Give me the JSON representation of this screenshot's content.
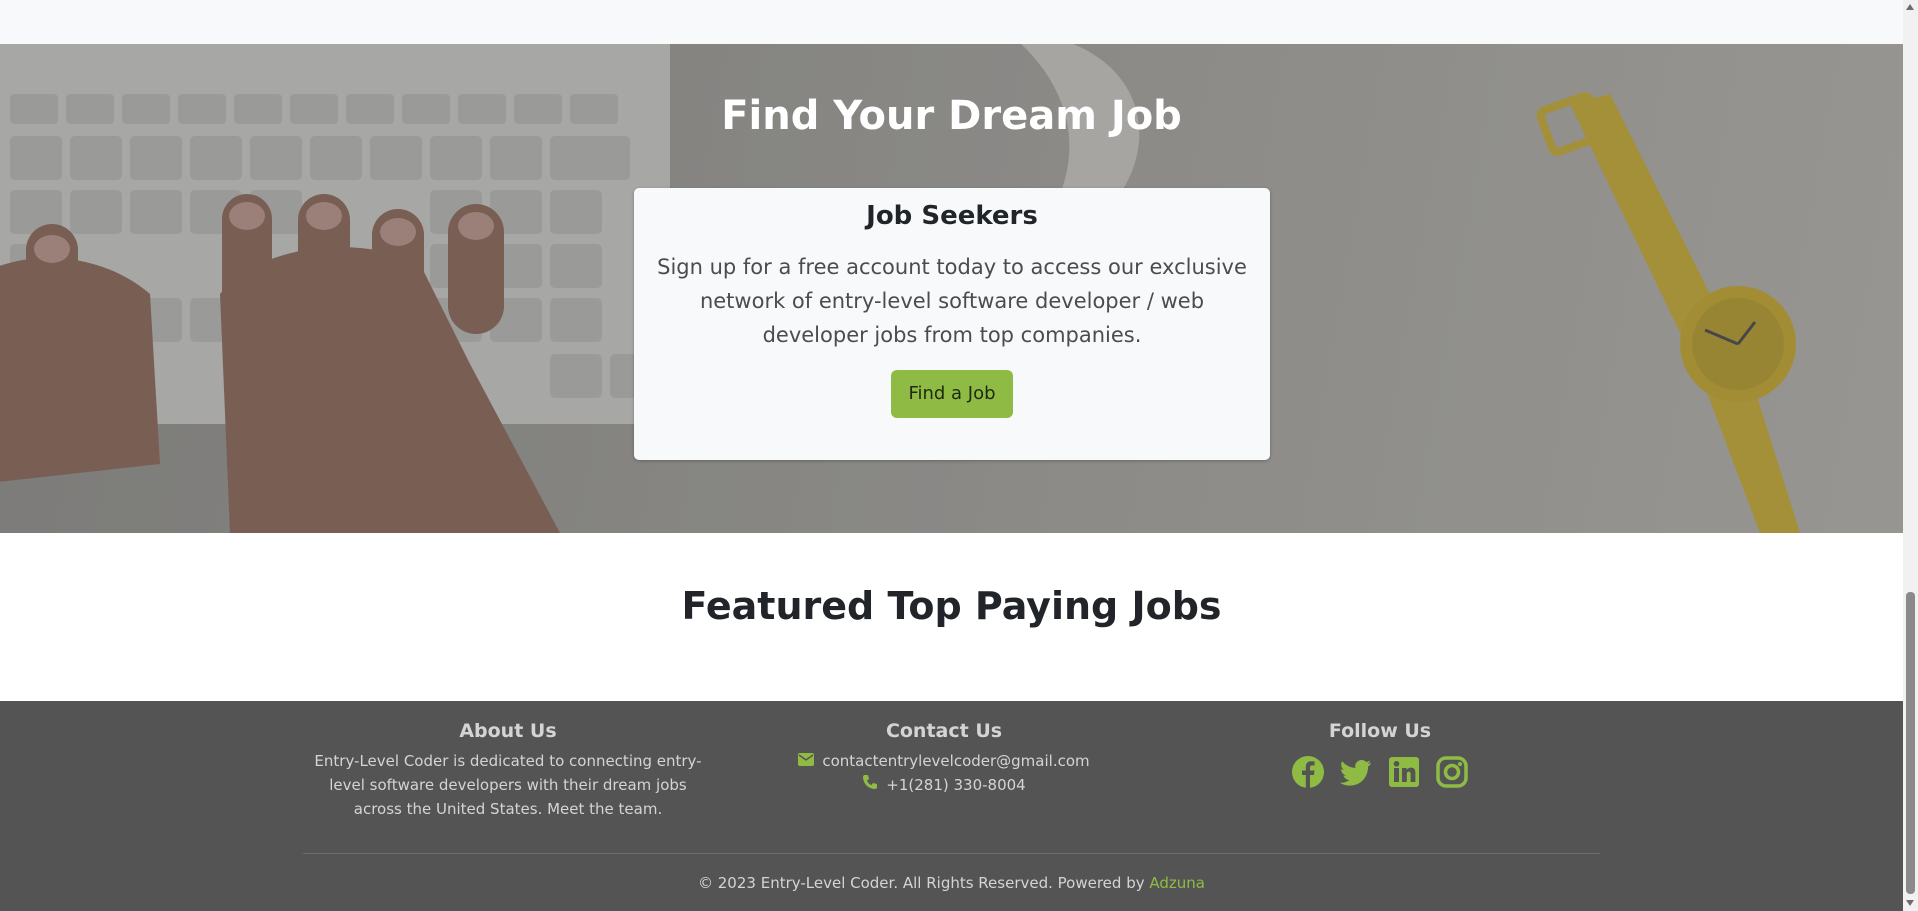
{
  "hero": {
    "title": "Find Your Dream Job",
    "card": {
      "heading": "Job Seekers",
      "text": "Sign up for a free account today to access our exclusive network of entry-level software developer / web developer jobs from top companies.",
      "button_label": "Find a Job"
    }
  },
  "featured": {
    "heading": "Featured Top Paying Jobs"
  },
  "footer": {
    "about": {
      "heading": "About Us",
      "text": "Entry-Level Coder is dedicated to connecting entry-level software developers with their dream jobs across the United States. Meet the team."
    },
    "contact": {
      "heading": "Contact Us",
      "email": "contactentrylevelcoder@gmail.com",
      "phone": "+1(281) 330-8004"
    },
    "follow": {
      "heading": "Follow Us",
      "icons": [
        "facebook-icon",
        "twitter-icon",
        "linkedin-icon",
        "instagram-icon"
      ]
    },
    "copyright": "© 2023 Entry-Level Coder. All Rights Reserved. Powered by",
    "powered_link": "Adzuna"
  },
  "colors": {
    "accent": "#8fbb45",
    "footer_bg": "#545454",
    "card_bg": "#f8f9fa"
  }
}
